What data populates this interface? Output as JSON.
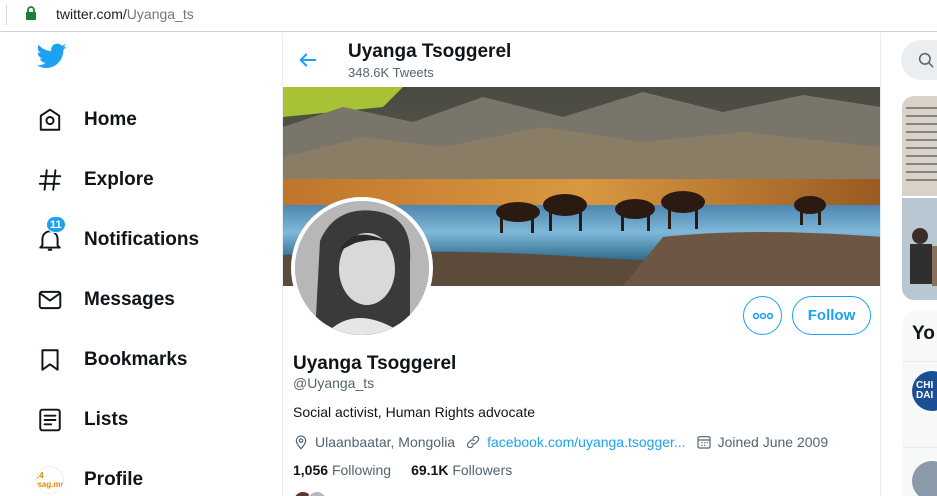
{
  "browser": {
    "url_host": "twitter.com/",
    "url_path": "Uyanga_ts"
  },
  "nav": {
    "items": [
      {
        "label": "Home",
        "icon": "home-icon"
      },
      {
        "label": "Explore",
        "icon": "hashtag-icon"
      },
      {
        "label": "Notifications",
        "icon": "bell-icon",
        "badge": "11"
      },
      {
        "label": "Messages",
        "icon": "envelope-icon"
      },
      {
        "label": "Bookmarks",
        "icon": "bookmark-icon"
      },
      {
        "label": "Lists",
        "icon": "list-icon"
      },
      {
        "label": "Profile",
        "icon": "profile-avatar"
      }
    ],
    "profile_avatar_text": "24 tsag.mn"
  },
  "header": {
    "name": "Uyanga Tsoggerel",
    "tweet_count": "348.6K Tweets"
  },
  "profile": {
    "name": "Uyanga Tsoggerel",
    "handle": "@Uyanga_ts",
    "bio": "Social activist, Human Rights advocate",
    "location": "Ulaanbaatar, Mongolia",
    "website": "facebook.com/uyanga.tsogger...",
    "joined": "Joined June 2009",
    "following_count": "1,056",
    "following_label": "Following",
    "followers_count": "69.1K",
    "followers_label": "Followers",
    "follow_button": "Follow"
  },
  "right": {
    "panel_title": "Yo",
    "avatar_text": "CHI DAI"
  },
  "colors": {
    "accent": "#1da1f2",
    "text": "#0f1419",
    "secondary": "#536471"
  }
}
